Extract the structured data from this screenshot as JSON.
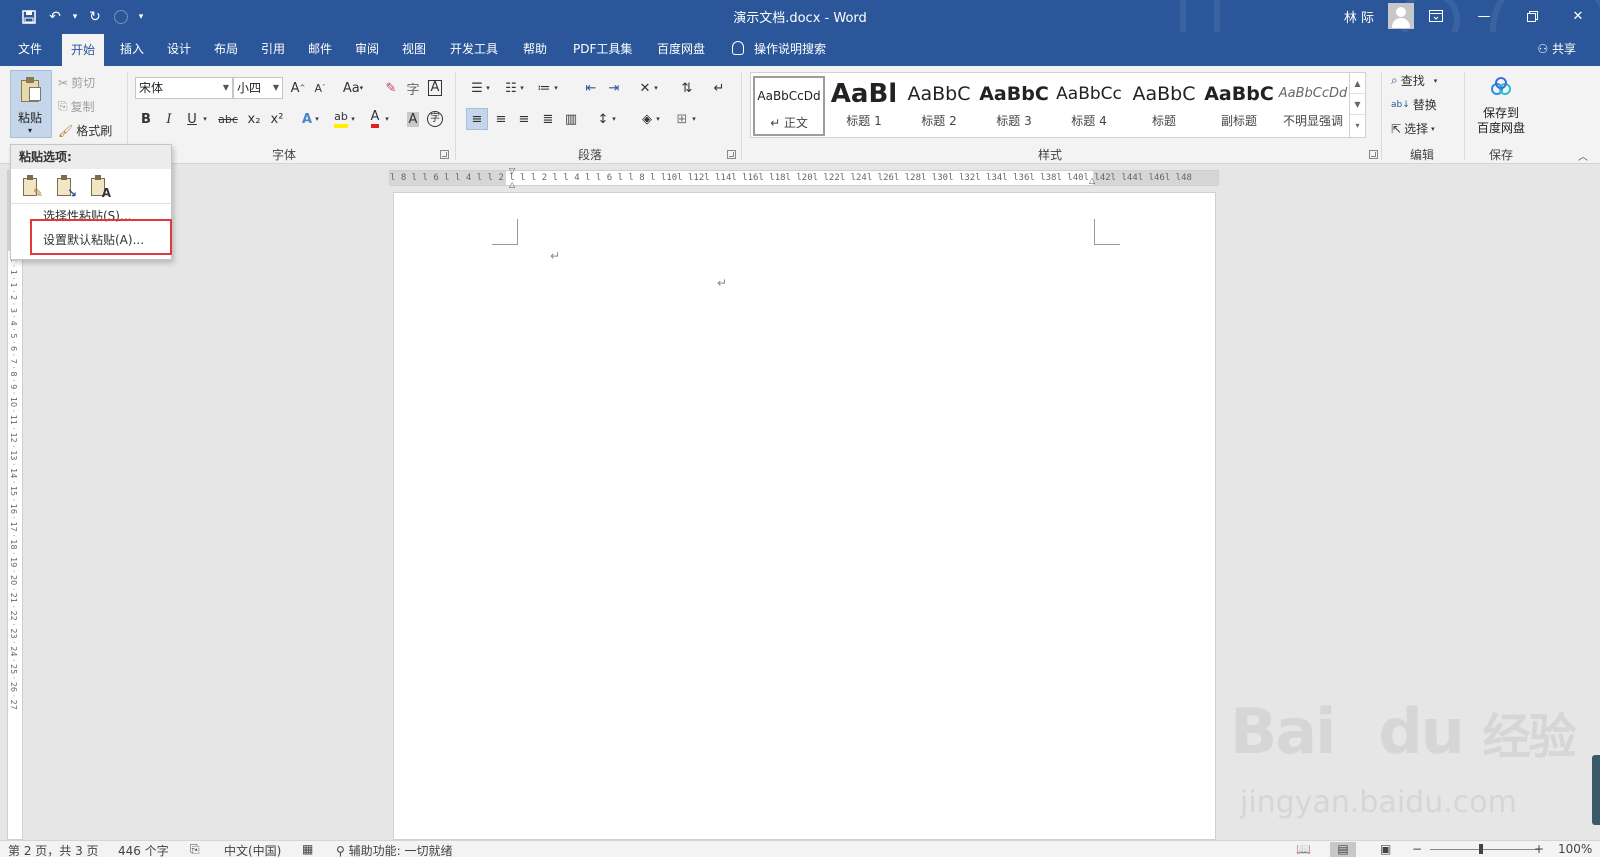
{
  "window": {
    "title": "演示文档.docx  -  Word",
    "user": "林 际",
    "qat_dropdown": "▾"
  },
  "tabs": [
    {
      "label": "文件"
    },
    {
      "label": "开始"
    },
    {
      "label": "插入"
    },
    {
      "label": "设计"
    },
    {
      "label": "布局"
    },
    {
      "label": "引用"
    },
    {
      "label": "邮件"
    },
    {
      "label": "审阅"
    },
    {
      "label": "视图"
    },
    {
      "label": "开发工具"
    },
    {
      "label": "帮助"
    },
    {
      "label": "PDF工具集"
    },
    {
      "label": "百度网盘"
    }
  ],
  "active_tab": "开始",
  "tell_me": "操作说明搜索",
  "share": "共享",
  "clipboard": {
    "paste": "粘贴",
    "cut": "剪切",
    "copy": "复制",
    "format_painter": "格式刷"
  },
  "font": {
    "group_label": "字体",
    "font_name": "宋体",
    "font_size": "小四",
    "bold": "B",
    "italic": "I",
    "underline": "U",
    "strike": "abc",
    "subscript": "x₂",
    "superscript": "x²",
    "font_color": "A",
    "char_shading": "A",
    "grow": "A",
    "shrink": "A",
    "case": "Aa",
    "phonetic": "字",
    "border": "A",
    "text_effect": "A",
    "enclose": "字"
  },
  "paragraph": {
    "group_label": "段落"
  },
  "styles": {
    "group_label": "样式",
    "items": [
      {
        "sample": "AaBbCcDd",
        "name": "↵ 正文"
      },
      {
        "sample": "AaBl",
        "name": "标题 1"
      },
      {
        "sample": "AaBbC",
        "name": "标题 2"
      },
      {
        "sample": "AaBbC",
        "name": "标题 3"
      },
      {
        "sample": "AaBbCc",
        "name": "标题 4"
      },
      {
        "sample": "AaBbC",
        "name": "标题"
      },
      {
        "sample": "AaBbC",
        "name": "副标题"
      },
      {
        "sample": "AaBbCcDd",
        "name": "不明显强调"
      }
    ]
  },
  "editing": {
    "group_label": "编辑",
    "find": "查找",
    "replace": "替换",
    "select": "选择"
  },
  "save_group": {
    "group_label": "保存",
    "save_to_baidu_line1": "保存到",
    "save_to_baidu_line2": "百度网盘"
  },
  "paste_menu": {
    "header": "粘贴选项:",
    "items": [
      {
        "label": "选择性粘贴(S)..."
      },
      {
        "label": "设置默认粘贴(A)..."
      }
    ]
  },
  "ruler": {
    "horizontal": "l 8 l  l 6 l  l 4 l  l 2 l  l     l  2 l  l 4 l  l 6 l  l 8 l  l10l  l12l  l14l  l16l  l18l  l20l  l22l  l24l  l26l  l28l  l30l  l32l  l34l  l36l  l38l  l40l  l42l  l44l  l46l  l48",
    "vertical": "1 · 1 · 1 · 2 · 3 · 4 · 5 · 6 · 7 · 8 · 9 · 10 · 11 · 12 · 13 · 14 · 15 · 16 · 17 · 18 · 19 · 20 · 21 · 22 · 23 · 24 · 25 · 26 · 27"
  },
  "document": {
    "para_mark_1": "↵",
    "para_mark_2": "↵"
  },
  "status": {
    "page": "第 2 页，共 3 页",
    "words": "446 个字",
    "language": "中文(中国)",
    "accessibility": "辅助功能: 一切就绪",
    "zoom_minus": "−",
    "zoom_plus": "+",
    "zoom": "100%"
  },
  "watermark": {
    "brand": "Bai",
    "brand2": "du",
    "brand_cn": "经验",
    "url": "jingyan.baidu.com"
  },
  "colors": {
    "titlebar": "#2b579a",
    "ribbon": "#f3f3f3",
    "highlight_box": "#e0393c"
  }
}
